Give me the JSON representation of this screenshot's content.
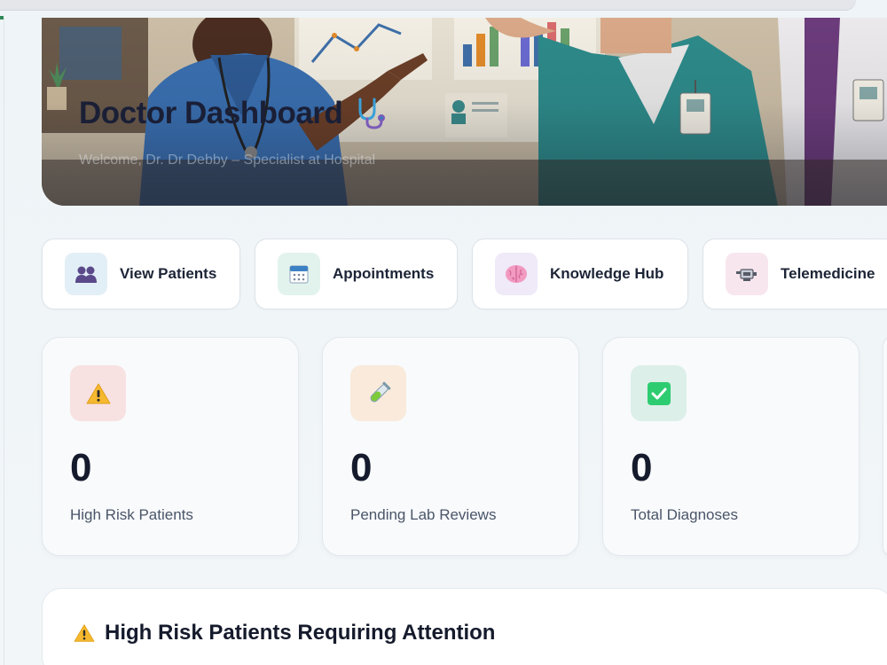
{
  "hero": {
    "title": "Doctor Dashboard",
    "welcome": "Welcome, Dr. Dr Debby – Specialist at Hospital",
    "title_icon": "stethoscope-icon"
  },
  "quick_actions": [
    {
      "label": "View Patients",
      "icon": "people-icon",
      "bg": "#e3eff6"
    },
    {
      "label": "Appointments",
      "icon": "calendar-icon",
      "bg": "#e2f3ee"
    },
    {
      "label": "Knowledge Hub",
      "icon": "brain-icon",
      "bg": "#efe9f8"
    },
    {
      "label": "Telemedicine",
      "icon": "video-camera-icon",
      "bg": "#f8e6ee"
    }
  ],
  "stats": [
    {
      "value": "0",
      "label": "High Risk Patients",
      "icon": "warning-icon",
      "bg": "#f8e1e1"
    },
    {
      "value": "0",
      "label": "Pending Lab Reviews",
      "icon": "test-tube-icon",
      "bg": "#f9eadb"
    },
    {
      "value": "0",
      "label": "Total Diagnoses",
      "icon": "check-icon",
      "bg": "#dcefe8"
    }
  ],
  "panel": {
    "title": "High Risk Patients Requiring Attention",
    "icon": "warning-icon"
  },
  "colors": {
    "background": "#eef4f7",
    "card": "#ffffff",
    "text": "#141b2b",
    "muted": "#4a5568",
    "warning": "#f5b82e",
    "success": "#2ecc71"
  }
}
